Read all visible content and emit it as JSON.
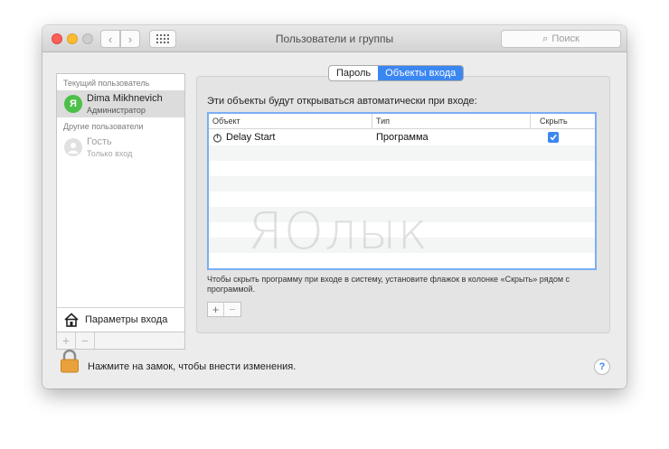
{
  "window": {
    "title": "Пользователи и группы"
  },
  "toolbar": {
    "back_icon": "chevron-left-icon",
    "forward_icon": "chevron-right-icon",
    "show_all_icon": "grid-icon"
  },
  "search": {
    "placeholder": "Поиск"
  },
  "sidebar": {
    "current_section": "Текущий пользователь",
    "current_user": {
      "name": "Dima Mikhnevich",
      "role": "Администратор",
      "avatar_letter": "Я"
    },
    "other_section": "Другие пользователи",
    "other_users": [
      {
        "name": "Гость",
        "role": "Только вход"
      }
    ],
    "login_options_label": "Параметры входа",
    "add_label": "+",
    "remove_label": "−"
  },
  "tabs": [
    {
      "label": "Пароль",
      "active": false
    },
    {
      "label": "Объекты входа",
      "active": true
    }
  ],
  "login_items": {
    "intro": "Эти объекты будут открываться автоматически при входе:",
    "columns": [
      "Объект",
      "Тип",
      "Скрыть"
    ],
    "rows": [
      {
        "name": "Delay Start",
        "type": "Программа",
        "hide": true
      }
    ],
    "watermark": "ЯOлык",
    "hint": "Чтобы скрыть программу при входе в систему, установите флажок в колонке «Скрыть» рядом с программой.",
    "add_label": "+",
    "remove_label": "−"
  },
  "footer": {
    "lock_text": "Нажмите на замок, чтобы внести изменения.",
    "help_label": "?"
  },
  "colors": {
    "accent": "#3b87f2",
    "avatar_green": "#4cc048",
    "lock_orange": "#e9a23b"
  }
}
